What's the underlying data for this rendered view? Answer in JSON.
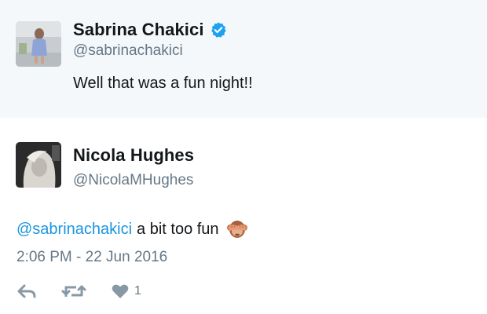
{
  "parent_tweet": {
    "display_name": "Sabrina Chakici",
    "verified": true,
    "handle": "@sabrinachakici",
    "text": "Well that was a fun night!!"
  },
  "reply_tweet": {
    "display_name": "Nicola Hughes",
    "handle": "@NicolaMHughes",
    "mention": "@sabrinachakici",
    "text": "a bit too fun",
    "emoji": "see-no-evil-monkey",
    "timestamp": "2:06 PM - 22 Jun 2016",
    "actions": {
      "reply_icon": "reply-icon",
      "retweet_icon": "retweet-icon",
      "like_icon": "heart-icon",
      "like_count": "1"
    }
  },
  "colors": {
    "parent_background": "#f5f8fa",
    "link_blue": "#1b95e0",
    "verified_blue": "#1da1f2",
    "muted_gray": "#657786",
    "icon_gray": "#8899a6",
    "text_dark": "#14171a"
  }
}
